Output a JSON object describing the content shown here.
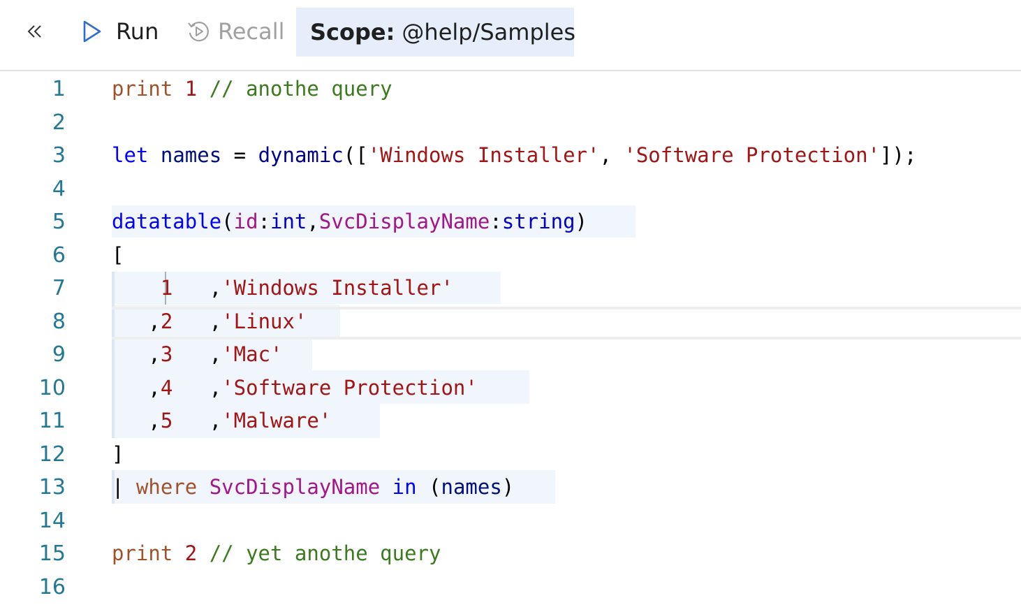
{
  "toolbar": {
    "collapse_icon": "double-chevron-left-icon",
    "run_icon": "play-icon",
    "run_label": "Run",
    "recall_icon": "recall-icon",
    "recall_label": "Recall",
    "scope_label": "Scope:",
    "scope_value": "@help/Samples"
  },
  "editor": {
    "line_numbers": [
      "1",
      "2",
      "3",
      "4",
      "5",
      "6",
      "7",
      "8",
      "9",
      "10",
      "11",
      "12",
      "13",
      "14",
      "15",
      "16"
    ],
    "lines": {
      "l1": {
        "cmd": "print",
        "num": "1",
        "comment": "// anothe query"
      },
      "l3": {
        "kw": "let",
        "var": "names",
        "eq": "=",
        "fn": "dynamic",
        "open": "([",
        "s1": "'Windows Installer'",
        "comma": ",",
        "s2": "'Software Protection'",
        "close": "]);"
      },
      "l5": {
        "fn": "datatable",
        "open": "(",
        "c1": "id",
        "colon1": ":",
        "t1": "int",
        "comma": ",",
        "c2": "SvcDisplayName",
        "colon2": ":",
        "t2": "string",
        "close": ")"
      },
      "l6": {
        "text": "["
      },
      "l7": {
        "num": "1",
        "comma": ",",
        "str": "'Windows Installer'"
      },
      "l8": {
        "lead": ",",
        "num": "2",
        "comma": ",",
        "str": "'Linux'"
      },
      "l9": {
        "lead": ",",
        "num": "3",
        "comma": ",",
        "str": "'Mac'"
      },
      "l10": {
        "lead": ",",
        "num": "4",
        "comma": ",",
        "str": "'Software Protection'"
      },
      "l11": {
        "lead": ",",
        "num": "5",
        "comma": ",",
        "str": "'Malware'"
      },
      "l12": {
        "text": "]"
      },
      "l13": {
        "pipe": "|",
        "op": "where",
        "col": "SvcDisplayName",
        "kw": "in",
        "open": "(",
        "var": "names",
        "close": ")"
      },
      "l15": {
        "cmd": "print",
        "num": "2",
        "comment": "// yet anothe query"
      }
    }
  },
  "colors": {
    "keyword": "#0000ff",
    "string": "#a31515",
    "command": "#a0522d",
    "column": "#a3168a",
    "comment": "#3b7a1e",
    "line_number": "#237893",
    "scope_bg": "#e5eefa",
    "query_highlight": "#f1f6fd"
  }
}
